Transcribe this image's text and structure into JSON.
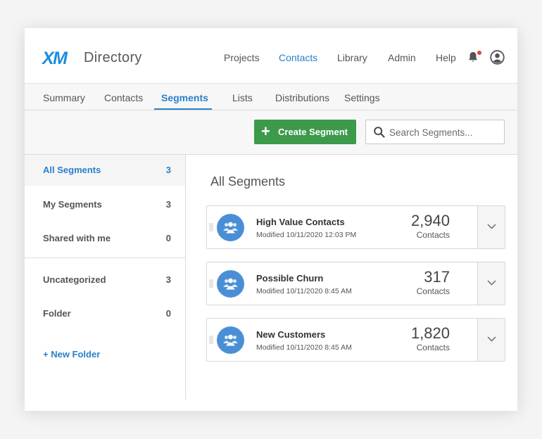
{
  "header": {
    "logo": "XM",
    "title": "Directory",
    "nav": [
      "Projects",
      "Contacts",
      "Library",
      "Admin",
      "Help"
    ],
    "active_nav": "Contacts",
    "notification_dot_color": "#e4433a"
  },
  "tabs": {
    "items": [
      "Summary",
      "Contacts",
      "Segments",
      "Lists",
      "Distributions",
      "Settings"
    ],
    "active": "Segments"
  },
  "toolbar": {
    "create_label": "Create Segment",
    "search_placeholder": "Search Segments...",
    "search_value": ""
  },
  "sidebar": {
    "items": [
      {
        "label": "All Segments",
        "count": "3"
      },
      {
        "label": "My Segments",
        "count": "3"
      },
      {
        "label": "Shared with me",
        "count": "0"
      },
      {
        "label": "Uncategorized",
        "count": "3"
      },
      {
        "label": "Folder",
        "count": "0"
      }
    ],
    "active": "All Segments",
    "new_folder_label": "+ New Folder"
  },
  "main": {
    "title": "All Segments",
    "segments": [
      {
        "name": "High Value Contacts",
        "modified": "Modified 10/11/2020 12:03 PM",
        "count": "2,940",
        "count_label": "Contacts"
      },
      {
        "name": "Possible Churn",
        "modified": "Modified 10/11/2020 8:45 AM",
        "count": "317",
        "count_label": "Contacts"
      },
      {
        "name": "New Customers",
        "modified": "Modified 10/11/2020 8:45 AM",
        "count": "1,820",
        "count_label": "Contacts"
      }
    ]
  },
  "colors": {
    "accent": "#2b7fcb",
    "create_button": "#3c9a4a",
    "segment_avatar": "#4a8fd6",
    "logo": "#1a8ce0"
  },
  "icons": {
    "notification": "bell-icon",
    "user": "user-circle-icon",
    "search": "search-icon",
    "create": "plus-icon",
    "segment": "people-group-icon",
    "expand": "chevron-down-icon"
  }
}
